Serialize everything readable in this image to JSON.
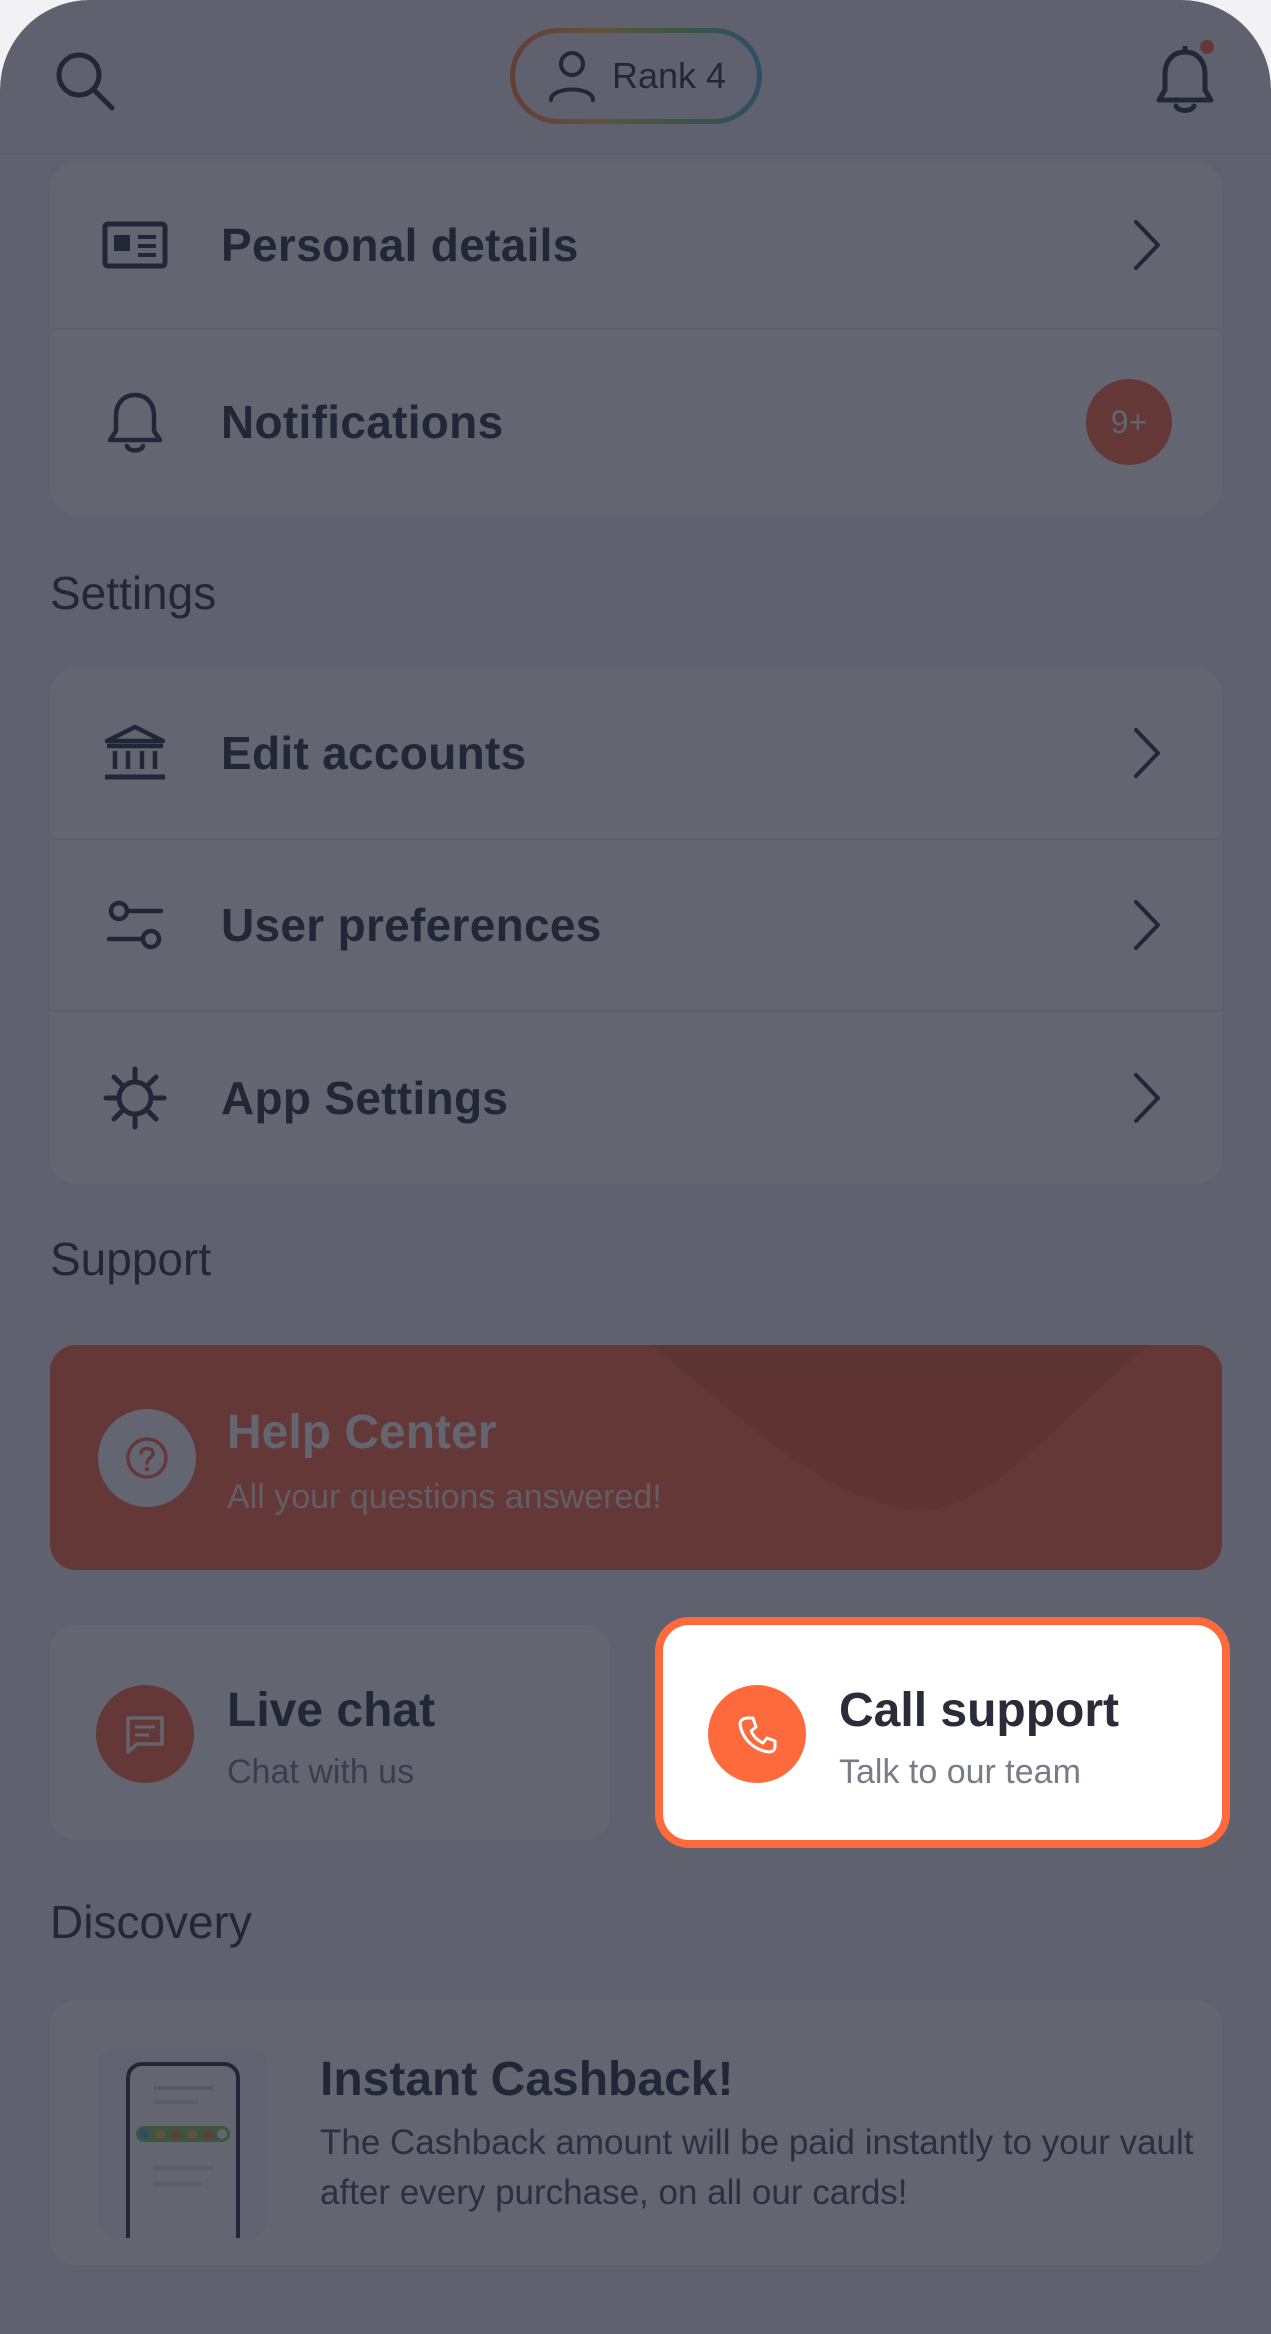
{
  "topbar": {
    "rank_label": "Rank 4",
    "search_icon": "search-icon",
    "bell_icon": "bell-icon",
    "has_unread_dot": true
  },
  "account_card": {
    "items": [
      {
        "label": "Personal details",
        "icon": "id-card-icon"
      },
      {
        "label": "Notifications",
        "icon": "bell-icon",
        "badge": "9+"
      }
    ]
  },
  "settings": {
    "title": "Settings",
    "items": [
      {
        "label": "Edit accounts",
        "icon": "bank-icon"
      },
      {
        "label": "User preferences",
        "icon": "sliders-icon"
      },
      {
        "label": "App Settings",
        "icon": "gear-icon"
      }
    ]
  },
  "support": {
    "title": "Support",
    "help_center": {
      "title": "Help Center",
      "subtitle": "All your questions answered!",
      "icon": "question-icon"
    },
    "live_chat": {
      "title": "Live chat",
      "subtitle": "Chat with us",
      "icon": "chat-icon"
    },
    "call_support": {
      "title": "Call support",
      "subtitle": "Talk to our team",
      "icon": "phone-icon"
    }
  },
  "discovery": {
    "title": "Discovery",
    "card": {
      "title": "Instant Cashback!",
      "text": "The Cashback amount will be paid instantly to your vault after every purchase, on all our cards!"
    }
  },
  "colors": {
    "accent": "#ff6a3d",
    "background": "#f2f2f5",
    "card": "#ffffff",
    "text": "#2b2c3a",
    "overlay": "rgba(33,35,52,0.70)"
  }
}
